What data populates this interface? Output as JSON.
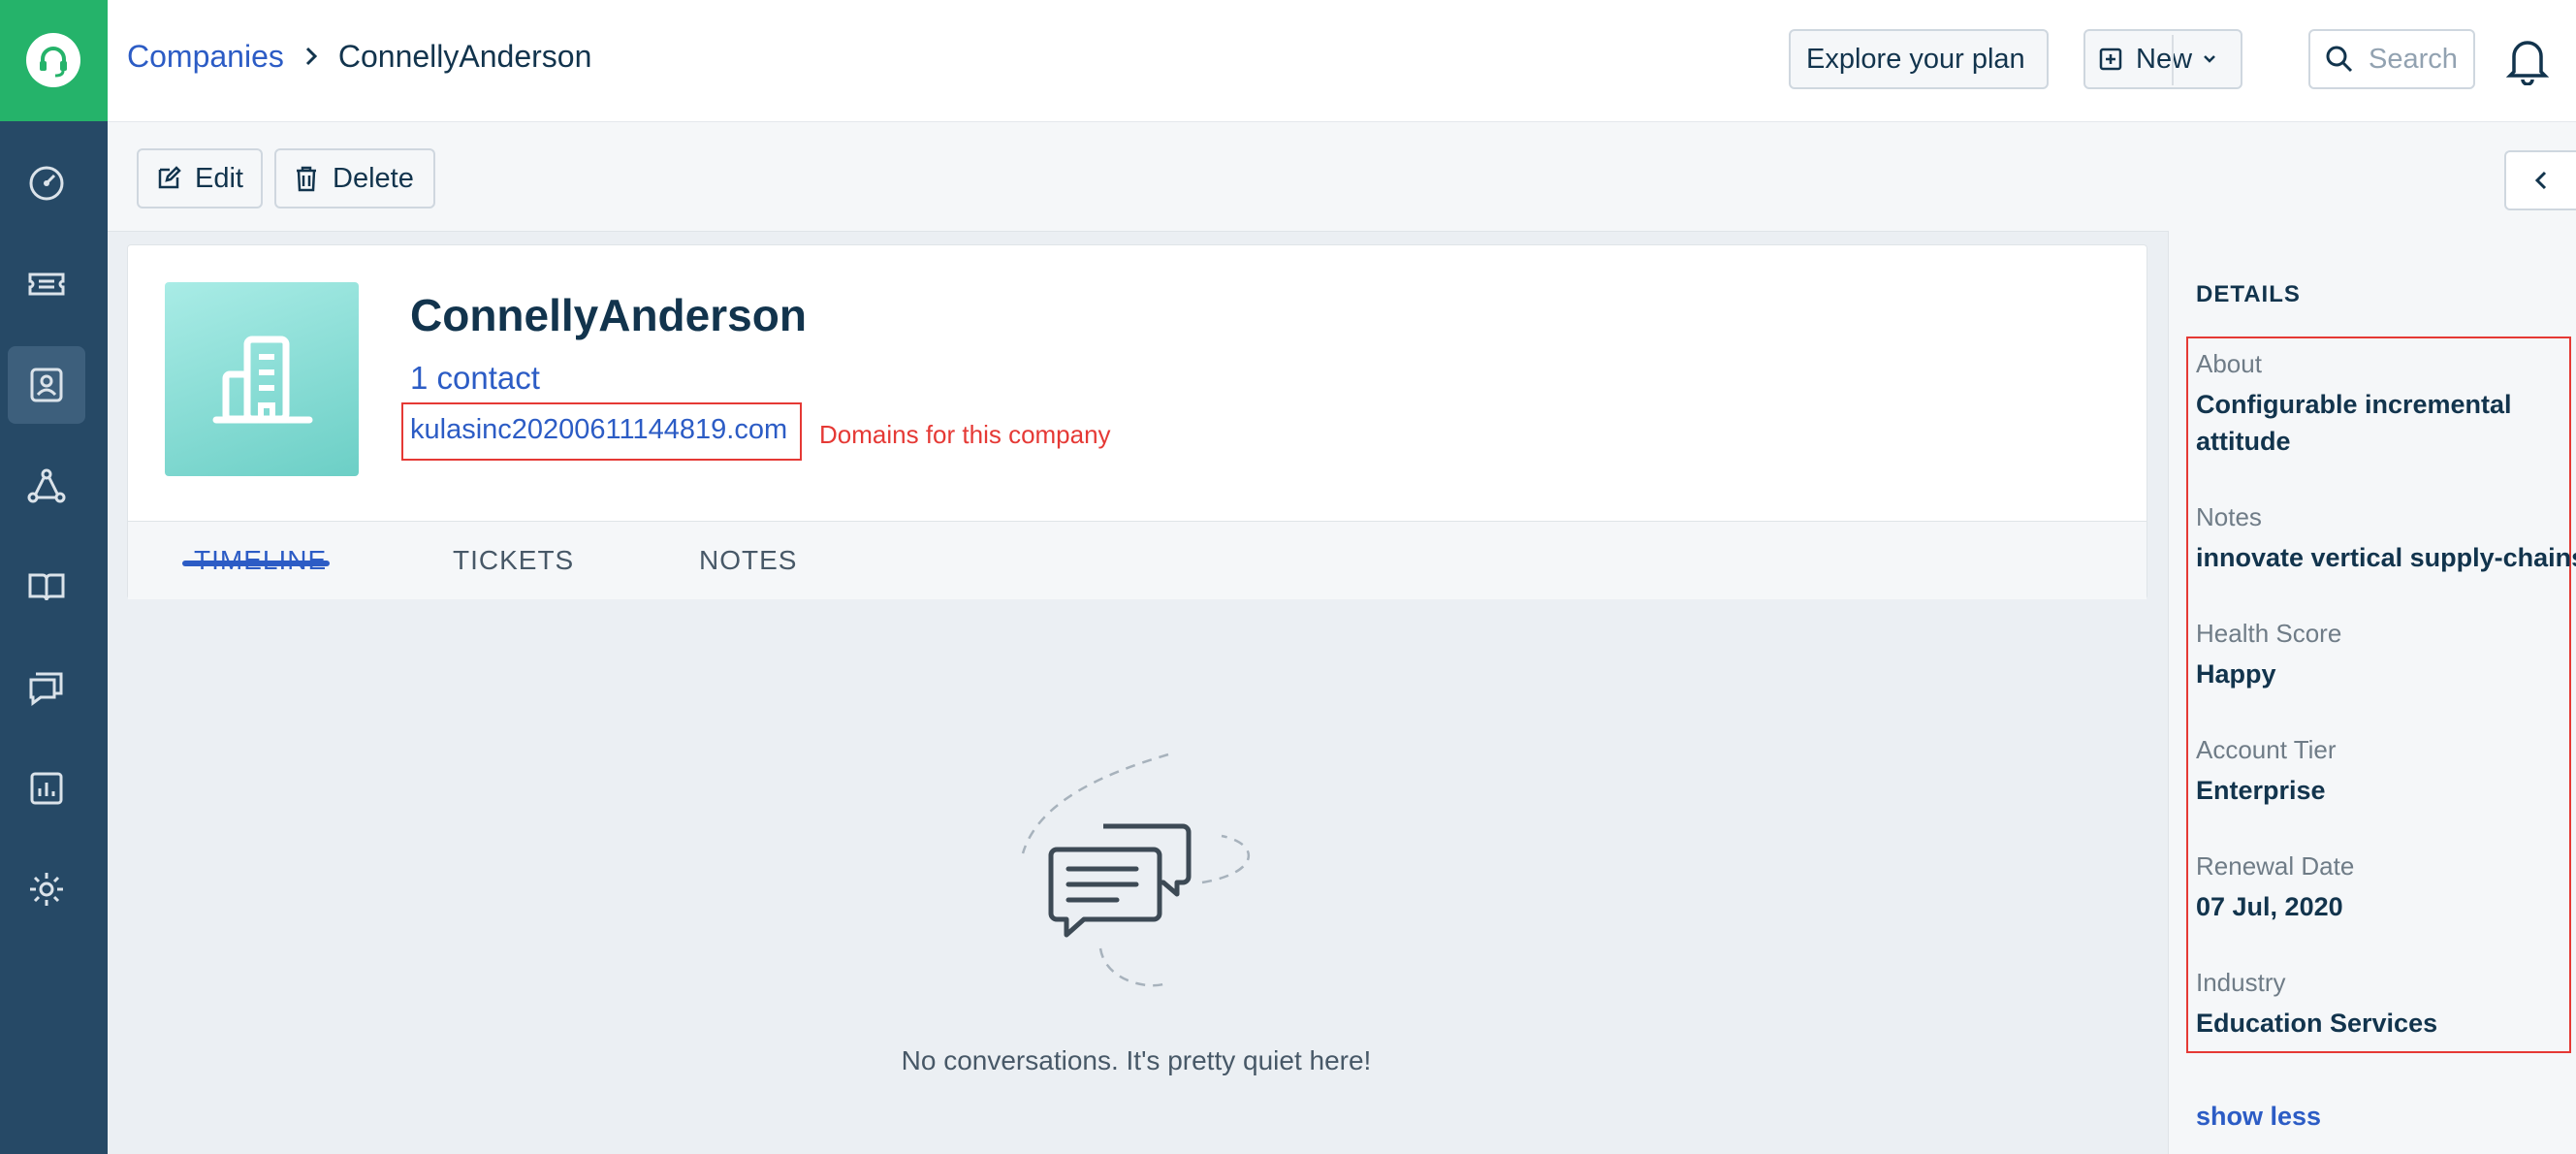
{
  "breadcrumb": {
    "parent": "Companies",
    "current": "ConnellyAnderson"
  },
  "header": {
    "explore_label": "Explore your plan",
    "new_label": "New",
    "search_placeholder": "Search"
  },
  "actions": {
    "edit_label": "Edit",
    "delete_label": "Delete"
  },
  "company": {
    "name": "ConnellyAnderson",
    "contacts": "1 contact",
    "domain": "kulasinc20200611144819.com",
    "domain_annotation": "Domains for this company"
  },
  "tabs": [
    "TIMELINE",
    "TICKETS",
    "NOTES"
  ],
  "empty_state": "No conversations. It's pretty quiet here!",
  "details": {
    "title": "DETAILS",
    "fields": [
      {
        "label": "About",
        "value": "Configurable incremental attitude"
      },
      {
        "label": "Notes",
        "value": "innovate vertical supply-chains"
      },
      {
        "label": "Health Score",
        "value": "Happy"
      },
      {
        "label": "Account Tier",
        "value": "Enterprise"
      },
      {
        "label": "Renewal Date",
        "value": "07 Jul, 2020"
      },
      {
        "label": "Industry",
        "value": "Education Services"
      }
    ],
    "show_less": "show less"
  },
  "colors": {
    "brand": "#25b36a",
    "link": "#2c5cc5",
    "nav": "#264966",
    "annotation": "#e53935"
  }
}
